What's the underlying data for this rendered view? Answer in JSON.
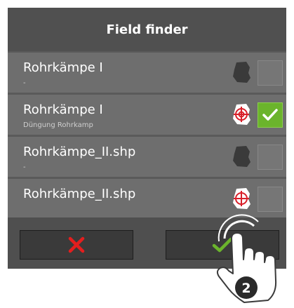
{
  "dialog": {
    "title": "Field finder",
    "rows": [
      {
        "name": "Rohrkämpe I",
        "subtitle": "-",
        "icon": "field-shape-icon",
        "checked": false
      },
      {
        "name": "Rohrkämpe I",
        "subtitle": "Düngung Rohrkamp",
        "icon": "target-field-icon",
        "checked": true
      },
      {
        "name": "Rohrkämpe_II.shp",
        "subtitle": "-",
        "icon": "field-shape-icon",
        "checked": false
      },
      {
        "name": "Rohrkämpe_II.shp",
        "subtitle": "",
        "icon": "target-field-icon",
        "checked": false
      }
    ],
    "buttons": {
      "cancel": "cancel-icon",
      "confirm": "confirm-icon"
    }
  },
  "overlay": {
    "step_number": "2"
  },
  "colors": {
    "accept_green": "#6bb42c",
    "cancel_red": "#e41e1e",
    "target_red": "#d8202a"
  }
}
